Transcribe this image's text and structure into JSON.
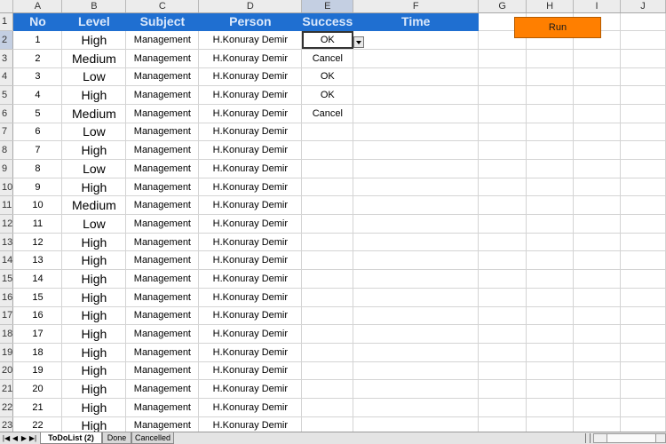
{
  "columns": [
    "A",
    "B",
    "C",
    "D",
    "E",
    "F",
    "G",
    "H",
    "I",
    "J"
  ],
  "selected_column": "E",
  "header": {
    "no": "No",
    "level": "Level",
    "subject": "Subject",
    "person": "Person",
    "success": "Success",
    "time": "Time"
  },
  "row_numbers": [
    "1",
    "2",
    "3",
    "4",
    "5",
    "6",
    "7",
    "8",
    "9",
    "10",
    "11",
    "12",
    "13",
    "14",
    "15",
    "16",
    "17",
    "18",
    "19",
    "20",
    "21",
    "22",
    "23"
  ],
  "selected_row": "2",
  "rows": [
    {
      "no": "1",
      "level": "High",
      "subject": "Management",
      "person": "H.Konuray Demir",
      "success": "OK"
    },
    {
      "no": "2",
      "level": "Medium",
      "subject": "Management",
      "person": "H.Konuray Demir",
      "success": "Cancel"
    },
    {
      "no": "3",
      "level": "Low",
      "subject": "Management",
      "person": "H.Konuray Demir",
      "success": "OK"
    },
    {
      "no": "4",
      "level": "High",
      "subject": "Management",
      "person": "H.Konuray Demir",
      "success": "OK"
    },
    {
      "no": "5",
      "level": "Medium",
      "subject": "Management",
      "person": "H.Konuray Demir",
      "success": "Cancel"
    },
    {
      "no": "6",
      "level": "Low",
      "subject": "Management",
      "person": "H.Konuray Demir",
      "success": ""
    },
    {
      "no": "7",
      "level": "High",
      "subject": "Management",
      "person": "H.Konuray Demir",
      "success": ""
    },
    {
      "no": "8",
      "level": "Low",
      "subject": "Management",
      "person": "H.Konuray Demir",
      "success": ""
    },
    {
      "no": "9",
      "level": "High",
      "subject": "Management",
      "person": "H.Konuray Demir",
      "success": ""
    },
    {
      "no": "10",
      "level": "Medium",
      "subject": "Management",
      "person": "H.Konuray Demir",
      "success": ""
    },
    {
      "no": "11",
      "level": "Low",
      "subject": "Management",
      "person": "H.Konuray Demir",
      "success": ""
    },
    {
      "no": "12",
      "level": "High",
      "subject": "Management",
      "person": "H.Konuray Demir",
      "success": ""
    },
    {
      "no": "13",
      "level": "High",
      "subject": "Management",
      "person": "H.Konuray Demir",
      "success": ""
    },
    {
      "no": "14",
      "level": "High",
      "subject": "Management",
      "person": "H.Konuray Demir",
      "success": ""
    },
    {
      "no": "15",
      "level": "High",
      "subject": "Management",
      "person": "H.Konuray Demir",
      "success": ""
    },
    {
      "no": "16",
      "level": "High",
      "subject": "Management",
      "person": "H.Konuray Demir",
      "success": ""
    },
    {
      "no": "17",
      "level": "High",
      "subject": "Management",
      "person": "H.Konuray Demir",
      "success": ""
    },
    {
      "no": "18",
      "level": "High",
      "subject": "Management",
      "person": "H.Konuray Demir",
      "success": ""
    },
    {
      "no": "19",
      "level": "High",
      "subject": "Management",
      "person": "H.Konuray Demir",
      "success": ""
    },
    {
      "no": "20",
      "level": "High",
      "subject": "Management",
      "person": "H.Konuray Demir",
      "success": ""
    },
    {
      "no": "21",
      "level": "High",
      "subject": "Management",
      "person": "H.Konuray Demir",
      "success": ""
    },
    {
      "no": "22",
      "level": "High",
      "subject": "Management",
      "person": "H.Konuray Demir",
      "success": ""
    }
  ],
  "run_button": "Run",
  "sheet_tabs": [
    {
      "label": "ToDoList (2)",
      "active": true
    },
    {
      "label": "Done",
      "active": false
    },
    {
      "label": "Cancelled",
      "active": false
    }
  ],
  "icons": {
    "dropdown": "chevron-down-icon",
    "nav_first": "nav-first-icon",
    "nav_prev": "nav-prev-icon",
    "nav_next": "nav-next-icon",
    "nav_last": "nav-last-icon"
  },
  "colors": {
    "header_bg": "#1f6fd1",
    "header_text": "#dce9fb",
    "run_button": "#ff7f00",
    "selection_highlight": "#c4cfe2"
  }
}
